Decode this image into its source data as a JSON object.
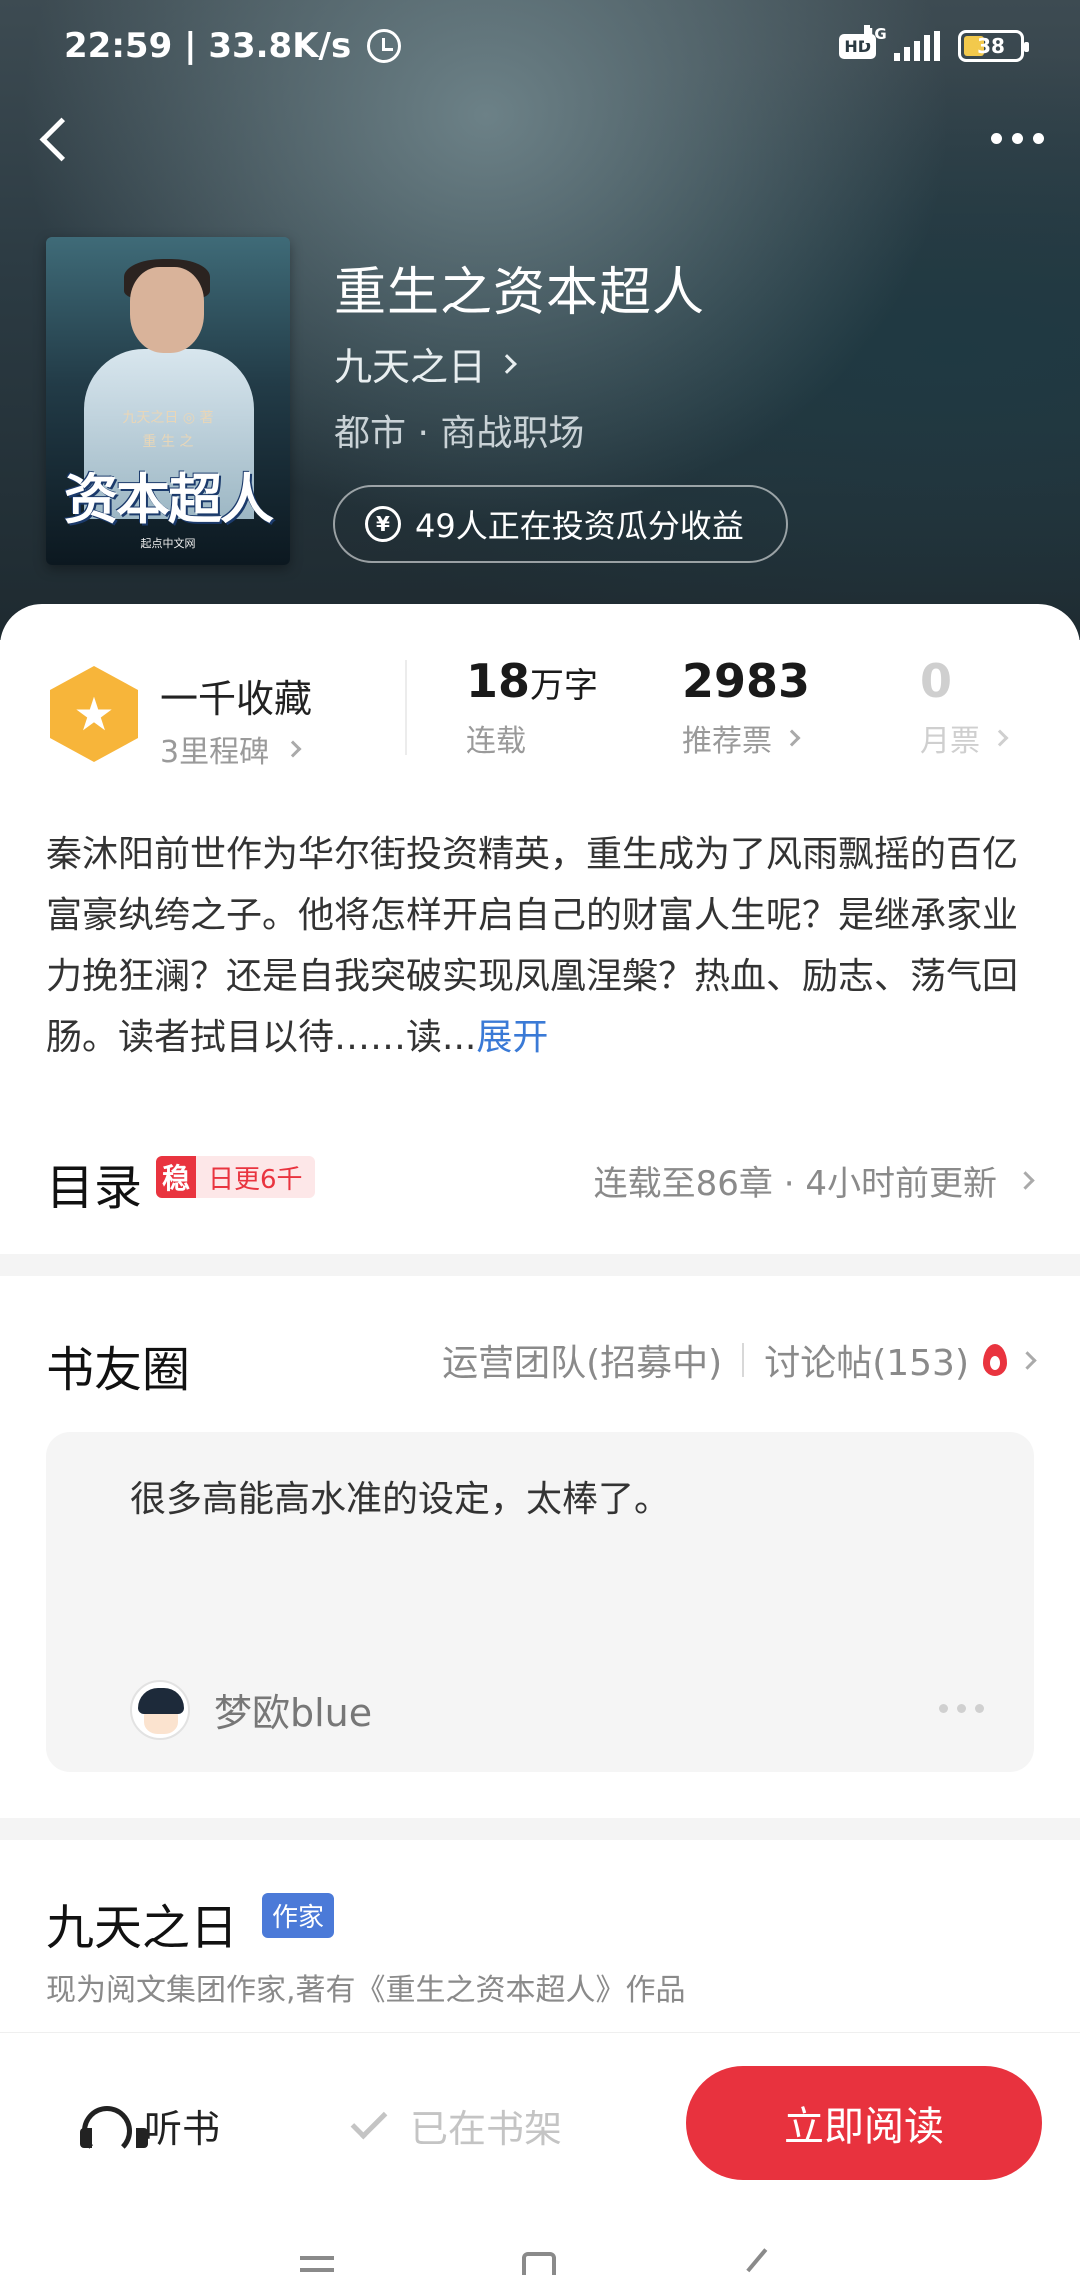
{
  "status_bar": {
    "time_speed": "22:59 | 33.8K/s",
    "hd": "HD",
    "network": "4G",
    "battery": "38"
  },
  "book": {
    "title": "重生之资本超人",
    "author": "九天之日",
    "genre": "都市 · 商战职场",
    "invest_text": "49人正在投资瓜分收益",
    "cover": {
      "small_text": "九天之日 ◎ 著",
      "big_text": "资本超人",
      "sub": "重 生 之",
      "publisher": "起点中文网"
    }
  },
  "stats": {
    "favorites": "一千收藏",
    "milestone": "3里程碑",
    "words_num": "18",
    "words_unit": "万字",
    "words_label": "连载",
    "recommend_num": "2983",
    "recommend_label": "推荐票",
    "monthly_num": "0",
    "monthly_label": "月票"
  },
  "synopsis": {
    "text": "秦沐阳前世作为华尔街投资精英，重生成为了风雨飘摇的百亿富豪纨绔之子。他将怎样开启自己的财富人生呢？是继承家业力挽狂澜？还是自我突破实现凤凰涅槃？热血、励志、荡气回肠。读者拭目以待……读...",
    "expand": "展开"
  },
  "toc": {
    "title": "目录",
    "tag_icon": "稳",
    "tag_text": "日更6千",
    "info": "连载至86章 · 4小时前更新"
  },
  "circle": {
    "title": "书友圈",
    "ops_team": "运营团队(招募中)",
    "discussion": "讨论帖(153)",
    "post_text": "很多高能高水准的设定，太棒了。",
    "post_user": "梦欧blue"
  },
  "author_section": {
    "name": "九天之日",
    "tag": "作家",
    "desc": "现为阅文集团作家,著有《重生之资本超人》作品"
  },
  "bottom_bar": {
    "listen": "听书",
    "on_shelf": "已在书架",
    "read_now": "立即阅读"
  }
}
